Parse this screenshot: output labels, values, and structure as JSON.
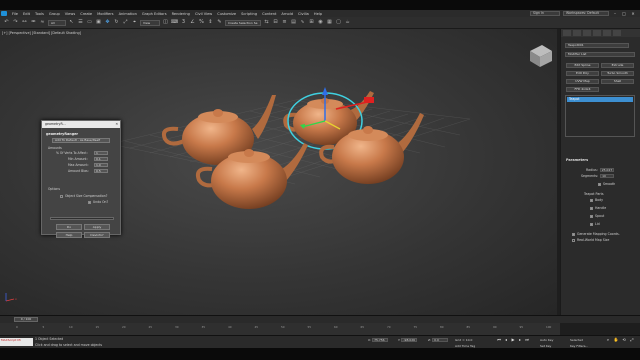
{
  "menu": {
    "items": [
      "File",
      "Edit",
      "Tools",
      "Group",
      "Views",
      "Create",
      "Modifiers",
      "Animation",
      "Graph Editors",
      "Rendering",
      "Civil View",
      "Customize",
      "Scripting",
      "Content",
      "Arnold",
      "Civilia",
      "Help"
    ],
    "signin": "Sign In",
    "workspace": "Workspaces: Default"
  },
  "toolbar": {
    "filter": "All",
    "view": "View",
    "selection_set": "Create Selection Se"
  },
  "viewport": {
    "label": "[+] [Perspective] [Standard] [Default Shading]",
    "axis_x": "x"
  },
  "dialog": {
    "title": "geometryR...",
    "heading": "geometryRanger",
    "dropdown": "Add To Default - As Base/Itself",
    "amounts_label": "Amounts",
    "pct_label": "% Of Verts To Affect:",
    "pct_value": "1",
    "min_label": "Min Amount:",
    "min_value": "0.1",
    "max_label": "Max Amount:",
    "max_value": "1.0",
    "bias_label": "Amount Bias:",
    "bias_value": "0.5",
    "options_label": "Options",
    "size_comp": "Object Size Compensation?",
    "undo": "Undo On?",
    "do_btn": "Do",
    "apply_btn": "Apply",
    "help_btn": "Help",
    "devinfo_btn": "DevInfo?"
  },
  "command_panel": {
    "object_name": "Teapot001",
    "modifier_list": "Modifier List",
    "btn_edit_spline": "Edit Spline",
    "btn_extrude": "Extrude",
    "btn_edit_poly": "Edit Poly",
    "btn_turbosmooth": "Turbo Smooth",
    "btn_uvw_map": "UVW Map",
    "btn_shell": "Shell",
    "btn_ffd": "FFD 4x4x4",
    "stack_item": "Teapot",
    "parameters": "Parameters",
    "radius_label": "Radius:",
    "radius_value": "25.027",
    "segments_label": "Segments:",
    "segments_value": "10",
    "smooth": "Smooth",
    "parts_label": "Teapot Parts",
    "part_body": "Body",
    "part_handle": "Handle",
    "part_spout": "Spout",
    "part_lid": "Lid",
    "gen_coords": "Generate Mapping Coords.",
    "real_world": "Real-World Map Size"
  },
  "timeline": {
    "slider": "0 / 100",
    "ticks": [
      "0",
      "5",
      "10",
      "15",
      "20",
      "25",
      "30",
      "35",
      "40",
      "45",
      "50",
      "55",
      "60",
      "65",
      "70",
      "75",
      "80",
      "85",
      "90",
      "95",
      "100"
    ]
  },
  "status": {
    "selected": "1 Object Selected",
    "prompt": "Click and drag to select and move objects",
    "maxscript": "MAXScript Mi",
    "x_label": "X:",
    "x_value": "75.756",
    "y_label": "Y:",
    "y_value": "-98.026",
    "z_label": "Z:",
    "z_value": "0.0",
    "grid": "Grid = 10.0",
    "add_time_tag": "Add Time Tag",
    "auto_key": "Auto Key",
    "set_key": "Set Key",
    "selected_dd": "Selected",
    "key_filters": "Key Filters..."
  },
  "colors": {
    "teapot": "#c8794a",
    "selection": "#3fd0e0",
    "accent": "#3d8fd1"
  }
}
